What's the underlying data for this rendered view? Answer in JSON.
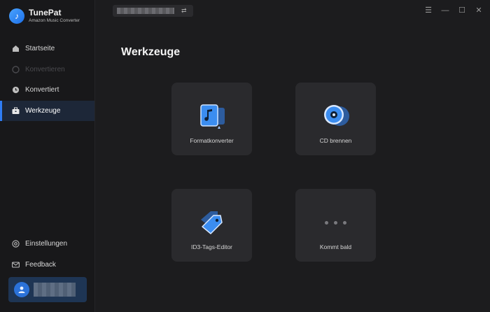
{
  "app": {
    "name": "TunePat",
    "subtitle": "Amazon Music Converter"
  },
  "sidebar": {
    "items": [
      {
        "label": "Startseite",
        "icon": "home-icon",
        "state": "normal"
      },
      {
        "label": "Konvertieren",
        "icon": "convert-icon",
        "state": "disabled"
      },
      {
        "label": "Konvertiert",
        "icon": "clock-icon",
        "state": "normal"
      },
      {
        "label": "Werkzeuge",
        "icon": "toolbox-icon",
        "state": "active"
      }
    ],
    "bottom_items": [
      {
        "label": "Einstellungen",
        "icon": "settings-icon"
      },
      {
        "label": "Feedback",
        "icon": "mail-icon"
      }
    ]
  },
  "topbar": {
    "swap_icon": "swap-icon"
  },
  "window_controls": [
    "menu-icon",
    "minimize-icon",
    "maximize-icon",
    "close-icon"
  ],
  "main": {
    "title": "Werkzeuge",
    "tools": [
      {
        "label": "Formatkonverter",
        "icon": "format-converter-icon"
      },
      {
        "label": "CD brennen",
        "icon": "cd-burn-icon"
      },
      {
        "label": "ID3-Tags-Editor",
        "icon": "tag-editor-icon"
      },
      {
        "label": "Kommt bald",
        "icon": "more-dots-icon"
      }
    ]
  },
  "colors": {
    "accent": "#2f7df6",
    "background": "#1c1c1e",
    "card": "#2a2a2d",
    "active_nav": "#1d2738"
  }
}
